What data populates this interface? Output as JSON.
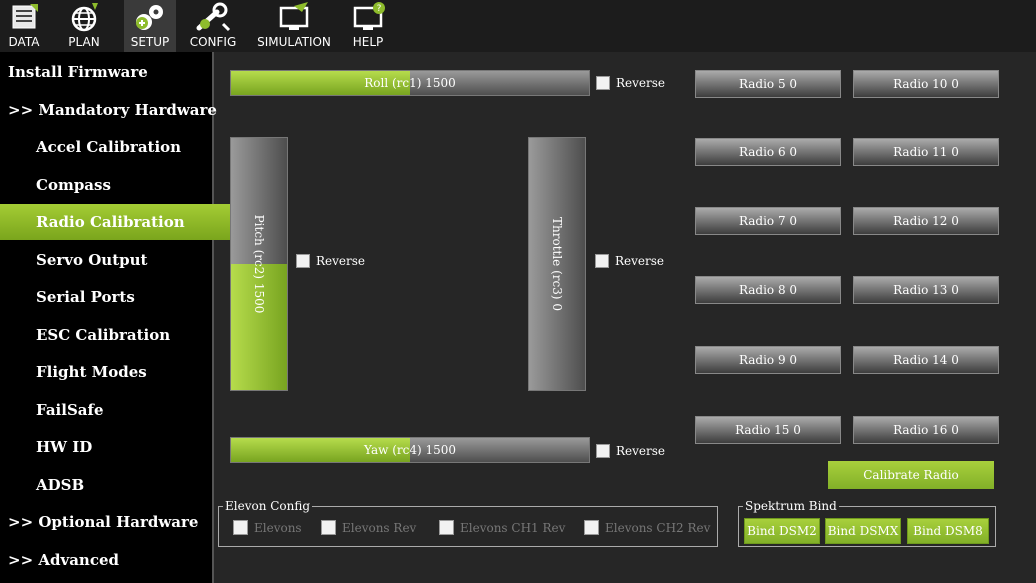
{
  "topnav": [
    {
      "label": "DATA",
      "icon": "monitor-data-icon"
    },
    {
      "label": "PLAN",
      "icon": "globe-icon"
    },
    {
      "label": "SETUP",
      "icon": "gears-icon"
    },
    {
      "label": "CONFIG",
      "icon": "wrench-icon"
    },
    {
      "label": "SIMULATION",
      "icon": "simulation-monitor-icon"
    },
    {
      "label": "HELP",
      "icon": "help-monitor-icon"
    }
  ],
  "sidebar": [
    {
      "label": "Install Firmware",
      "kind": "top"
    },
    {
      "label": ">> Mandatory Hardware",
      "kind": "top"
    },
    {
      "label": "Accel Calibration",
      "kind": "sub"
    },
    {
      "label": "Compass",
      "kind": "sub"
    },
    {
      "label": "Radio Calibration",
      "kind": "sub",
      "active": true
    },
    {
      "label": "Servo Output",
      "kind": "sub"
    },
    {
      "label": "Serial Ports",
      "kind": "sub"
    },
    {
      "label": "ESC Calibration",
      "kind": "sub"
    },
    {
      "label": "Flight Modes",
      "kind": "sub"
    },
    {
      "label": "FailSafe",
      "kind": "sub"
    },
    {
      "label": "HW ID",
      "kind": "sub"
    },
    {
      "label": "ADSB",
      "kind": "sub"
    },
    {
      "label": ">> Optional Hardware",
      "kind": "top"
    },
    {
      "label": ">> Advanced",
      "kind": "top"
    }
  ],
  "channels": {
    "roll": {
      "label": "Roll (rc1)  1500",
      "level": 0.5
    },
    "pitch": {
      "label": "Pitch (rc2)  1500",
      "level": 0.5
    },
    "throttle": {
      "label": "Throttle (rc3)  0",
      "level": 0
    },
    "yaw": {
      "label": "Yaw (rc4)  1500",
      "level": 0.5
    }
  },
  "reverse_label": "Reverse",
  "radios": [
    "Radio 5  0",
    "Radio 10  0",
    "Radio 6  0",
    "Radio 11  0",
    "Radio 7  0",
    "Radio 12  0",
    "Radio 8  0",
    "Radio 13  0",
    "Radio 9  0",
    "Radio 14  0",
    "Radio 15  0",
    "Radio 16  0"
  ],
  "calibrate_label": "Calibrate Radio",
  "elevon": {
    "title": "Elevon Config",
    "options": [
      "Elevons",
      "Elevons Rev",
      "Elevons CH1 Rev",
      "Elevons CH2 Rev"
    ]
  },
  "spektrum": {
    "title": "Spektrum Bind",
    "buttons": [
      "Bind DSM2",
      "Bind DSMX",
      "Bind DSM8"
    ]
  },
  "colors": {
    "accent": "#8ebc2c",
    "background": "#262626",
    "sidebar": "#000000"
  }
}
